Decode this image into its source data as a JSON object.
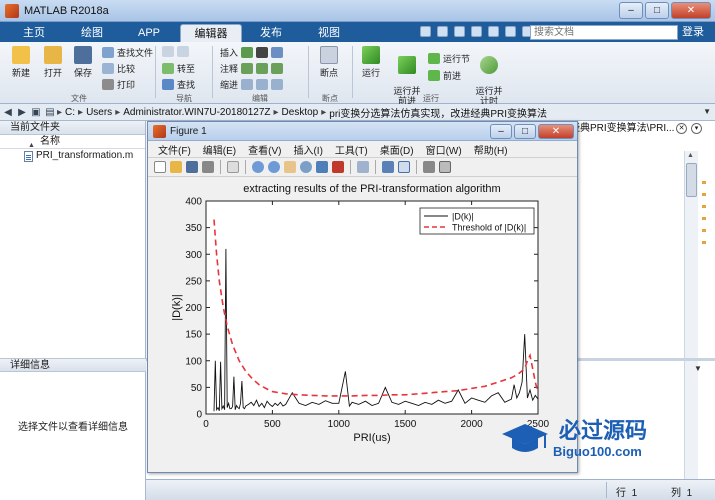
{
  "window": {
    "title": "MATLAB R2018a"
  },
  "tabs": [
    {
      "label": "主页"
    },
    {
      "label": "绘图"
    },
    {
      "label": "APP"
    },
    {
      "label": "编辑器"
    },
    {
      "label": "发布"
    },
    {
      "label": "视图"
    }
  ],
  "search": {
    "placeholder": "搜索文档"
  },
  "login_label": "登录",
  "ribbon": {
    "file": {
      "new": "新建",
      "open": "打开",
      "save": "保存",
      "find_files": "查找文件",
      "compare": "比较",
      "print": "打印",
      "group": "文件"
    },
    "navigate": {
      "goto": "转至",
      "find": "查找",
      "group": "导航"
    },
    "edit": {
      "insert": "插入",
      "comment": "注释",
      "indent": "缩进",
      "group": "编辑"
    },
    "breakpoints": {
      "label": "断点",
      "group": "断点"
    },
    "run": {
      "run": "运行",
      "run_advance": "运行并\n前进",
      "run_section": "运行节",
      "advance": "前进",
      "run_time": "运行并\n计时",
      "group": "运行"
    }
  },
  "address": {
    "crumbs": [
      "C:",
      "Users",
      "Administrator.WIN7U-20180127Z",
      "Desktop",
      "pri变换分选算法仿真实现，改进经典PRI变换算法"
    ]
  },
  "left_panel": {
    "title": "当前文件夹",
    "column": "名称",
    "files": [
      "PRI_transformation.m"
    ],
    "details_title": "详细信息",
    "details_hint": "选择文件以查看详细信息"
  },
  "right_panel": {
    "tab_label": "经典PRI变换算法\\PRI..."
  },
  "status": {
    "row_label": "行",
    "row_value": "1",
    "col_label": "列",
    "col_value": "1"
  },
  "figure": {
    "title": "Figure 1",
    "menu": [
      "文件(F)",
      "编辑(E)",
      "查看(V)",
      "插入(I)",
      "工具(T)",
      "桌面(D)",
      "窗口(W)",
      "帮助(H)"
    ]
  },
  "watermark": {
    "cn": "必过源码",
    "en": "Biguo100.com"
  },
  "colors": {
    "ribbon_blue": "#1f5c9c",
    "threshold_red": "#e8343a",
    "signal": "#111111"
  },
  "chart_data": {
    "type": "line",
    "title": "extracting results of the PRI-transformation algorithm",
    "xlabel": "PRI(us)",
    "ylabel": "|D(k)|",
    "xlim": [
      0,
      2500
    ],
    "ylim": [
      0,
      400
    ],
    "xticks": [
      0,
      500,
      1000,
      1500,
      2000,
      2500
    ],
    "yticks": [
      0,
      50,
      100,
      150,
      200,
      250,
      300,
      350,
      400
    ],
    "legend_position": "top-right",
    "series": [
      {
        "name": "|D(k)|",
        "style": "solid",
        "color": "#111111",
        "x": [
          60,
          70,
          80,
          90,
          100,
          110,
          120,
          130,
          140,
          150,
          160,
          170,
          180,
          190,
          200,
          210,
          220,
          230,
          240,
          250,
          260,
          270,
          280,
          290,
          300,
          320,
          340,
          360,
          380,
          400,
          420,
          440,
          460,
          480,
          500,
          520,
          540,
          560,
          580,
          600,
          650,
          700,
          750,
          800,
          850,
          900,
          950,
          1000,
          1050,
          1080,
          1100,
          1150,
          1200,
          1250,
          1300,
          1350,
          1400,
          1450,
          1500,
          1550,
          1600,
          1650,
          1700,
          1750,
          1800,
          1850,
          1900,
          1950,
          2000,
          2050,
          2100,
          2150,
          2200,
          2250,
          2300,
          2320,
          2340,
          2360,
          2380,
          2400,
          2420,
          2440,
          2460,
          2480,
          2500
        ],
        "y": [
          5,
          100,
          8,
          12,
          6,
          98,
          10,
          15,
          8,
          310,
          12,
          20,
          10,
          10,
          14,
          70,
          8,
          16,
          12,
          10,
          20,
          62,
          12,
          10,
          15,
          18,
          22,
          16,
          26,
          14,
          20,
          12,
          24,
          18,
          14,
          20,
          16,
          22,
          15,
          18,
          40,
          20,
          16,
          22,
          18,
          25,
          20,
          20,
          80,
          15,
          22,
          18,
          24,
          16,
          20,
          50,
          22,
          18,
          24,
          20,
          16,
          22,
          18,
          26,
          20,
          24,
          45,
          20,
          30,
          26,
          22,
          34,
          40,
          22,
          28,
          55,
          30,
          40,
          60,
          150,
          30,
          45,
          26,
          35,
          28
        ]
      },
      {
        "name": "Threshold of |D(k)|",
        "style": "dashed",
        "color": "#e8343a",
        "x": [
          60,
          80,
          100,
          130,
          160,
          200,
          250,
          300,
          350,
          400,
          450,
          500,
          600,
          700,
          800,
          900,
          1000,
          1100,
          1200,
          1300,
          1400,
          1500,
          1600,
          1700,
          1800,
          1900,
          2000,
          2100,
          2200,
          2300,
          2350,
          2400,
          2420,
          2440,
          2460,
          2480,
          2500
        ],
        "y": [
          365,
          300,
          250,
          200,
          165,
          130,
          100,
          80,
          66,
          55,
          48,
          42,
          38,
          36,
          35,
          34,
          34,
          34,
          35,
          35,
          36,
          36,
          38,
          40,
          42,
          44,
          48,
          52,
          60,
          68,
          75,
          85,
          100,
          110,
          85,
          60,
          40
        ]
      }
    ]
  }
}
